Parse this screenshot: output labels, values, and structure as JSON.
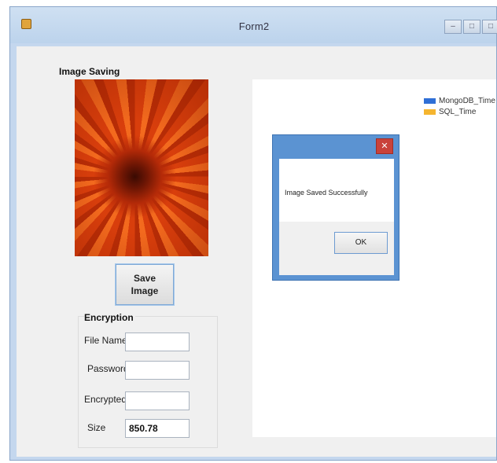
{
  "window": {
    "title": "Form2",
    "controls": [
      "–",
      "□",
      "□"
    ]
  },
  "image_group": {
    "label": "Image Saving",
    "save_button": "Save\nImage"
  },
  "encryption": {
    "label": "Encryption",
    "fields": [
      {
        "label": "File Name",
        "value": ""
      },
      {
        "label": "Password",
        "value": ""
      },
      {
        "label": "Encrypted",
        "value": ""
      },
      {
        "label": "Size",
        "value": "850.78"
      }
    ]
  },
  "chart": {
    "legend": [
      {
        "name": "MongoDB_Time",
        "color": "#2f6fd6"
      },
      {
        "name": "SQL_Time",
        "color": "#f5b52f"
      }
    ]
  },
  "dialog": {
    "message": "Image Saved Successfully",
    "ok_label": "OK",
    "close_glyph": "✕"
  }
}
